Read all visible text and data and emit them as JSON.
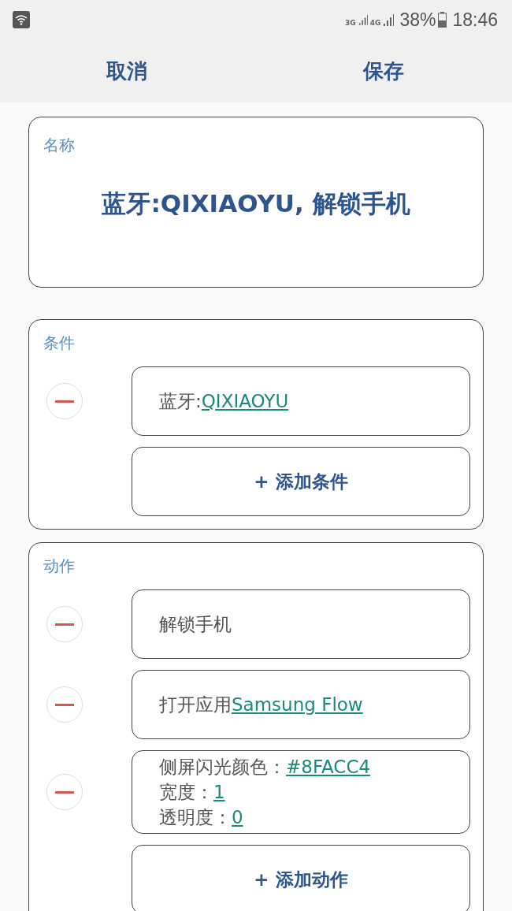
{
  "status_bar": {
    "network_3g": "3G",
    "network_4g": "4G",
    "battery": "38%",
    "time": "18:46"
  },
  "header": {
    "cancel": "取消",
    "save": "保存"
  },
  "name_card": {
    "label": "名称",
    "value": "蓝牙:QIXIAOYU, 解锁手机"
  },
  "sections": [
    {
      "label": "条件",
      "items": [
        {
          "lines": [
            {
              "text": "蓝牙:",
              "link": "QIXIAOYU"
            }
          ]
        }
      ],
      "add_button": "+ 添加条件"
    },
    {
      "label": "动作",
      "items": [
        {
          "lines": [
            {
              "text": "解锁手机"
            }
          ]
        },
        {
          "lines": [
            {
              "text": "打开应用",
              "link": "Samsung Flow"
            }
          ]
        },
        {
          "lines": [
            {
              "text": "侧屏闪光颜色：",
              "link": "#8FACC4"
            },
            {
              "text": "宽度：",
              "link": "1"
            },
            {
              "text": "透明度：",
              "link": "0"
            }
          ]
        }
      ],
      "add_button": "+ 添加动作"
    }
  ]
}
